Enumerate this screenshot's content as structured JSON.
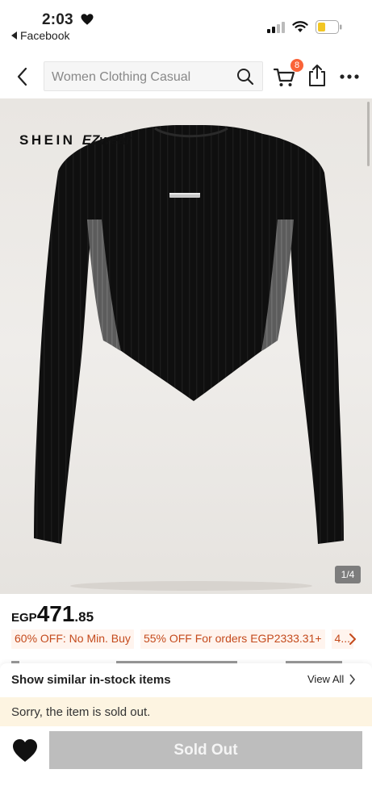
{
  "status_bar": {
    "time": "2:03",
    "back_app_label": "Facebook"
  },
  "nav": {
    "search_placeholder": "Women Clothing Casual",
    "cart_count": "8"
  },
  "product": {
    "brand": "SHEIN",
    "sub_brand": "EZwear",
    "image_counter": "1/4"
  },
  "price": {
    "currency": "EGP",
    "integer": "471",
    "decimal": ".85"
  },
  "promotions": [
    "60% OFF: No Min. Buy",
    "55% OFF For orders EGP2333.31+",
    "4..."
  ],
  "similar": {
    "title": "Show similar in-stock items",
    "view_all": "View All"
  },
  "notice": {
    "text": "Sorry, the item is sold out."
  },
  "actions": {
    "sold_out_label": "Sold Out"
  },
  "colors": {
    "badge": "#fa6338",
    "promo_text": "#c44a1c",
    "promo_bg": "#fff4ee",
    "notice_bg": "#fdf4e1",
    "disabled_button": "#bdbdbd"
  }
}
